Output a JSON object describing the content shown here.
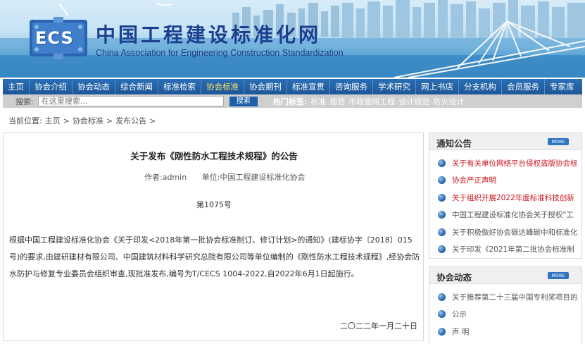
{
  "header": {
    "logo_text": "ECS",
    "site_title_cn": "中国工程建设标准化网",
    "site_title_en": "China Association for Engineering Construction Standardization"
  },
  "nav": {
    "items": [
      {
        "label": "主页",
        "active": false
      },
      {
        "label": "协会介绍",
        "active": false
      },
      {
        "label": "协会动态",
        "active": false
      },
      {
        "label": "综合新闻",
        "active": false
      },
      {
        "label": "标准检索",
        "active": false
      },
      {
        "label": "协会标准",
        "active": true
      },
      {
        "label": "协会期刊",
        "active": false
      },
      {
        "label": "标准宣贯",
        "active": false
      },
      {
        "label": "咨询服务",
        "active": false
      },
      {
        "label": "学术研究",
        "active": false
      },
      {
        "label": "网上书店",
        "active": false
      },
      {
        "label": "分支机构",
        "active": false
      },
      {
        "label": "会员服务",
        "active": false
      },
      {
        "label": "专家库",
        "active": false
      }
    ]
  },
  "search": {
    "label": "搜索:",
    "placeholder": "在这里搜索...",
    "button_label": "搜索",
    "hot_label": "热门标签:",
    "hot_tags": [
      "标准",
      "规范",
      "市政管网工程",
      "设计规范",
      "防火设计"
    ]
  },
  "breadcrumb": {
    "items": [
      "当前位置:",
      "主页",
      ">",
      "协会标准",
      ">",
      "发布公告",
      ">"
    ]
  },
  "article": {
    "title": "关于发布《刚性防水工程技术规程》的公告",
    "author": "作者:admin",
    "unit": "单位:中国工程建设标准化协会",
    "number": "第1075号",
    "body": "根据中国工程建设标准化协会《关于印发<2018年第一批协会标准制订、修订计划>的通知》(建标协字〔2018〕015号)的要求,由建研建材有限公司、中国建筑材料科学研究总院有限公司等单位编制的《刚性防水工程技术规程》,经协会防水防护与修复专业委员会组织审查,现批准发布,编号为T/CECS 1004-2022,自2022年6月1日起施行。",
    "date": "二〇二二年一月二十日"
  },
  "sidebar": {
    "notices": {
      "title": "通知公告",
      "more_label": "MORE",
      "items": [
        {
          "text": "关于有关单位网络平台侵权盗版协会标",
          "style": "red"
        },
        {
          "text": "协会严正声明",
          "style": "red"
        },
        {
          "text": "关于组织开展2022年度标准科技创新",
          "style": "red"
        },
        {
          "text": "中国工程建设标准化协会关于授权\"工",
          "style": "gray"
        },
        {
          "text": "关于积极做好协会碳达峰碳中和标准化",
          "style": "gray"
        },
        {
          "text": "关于印发《2021年第二批协会标准制",
          "style": "gray"
        }
      ]
    },
    "news": {
      "title": "协会动态",
      "more_label": "MORE",
      "items": [
        {
          "text": "关于推荐第二十三届中国专利奖项目的",
          "style": "gray"
        },
        {
          "text": "公示",
          "style": "gray"
        },
        {
          "text": "声 明",
          "style": "gray"
        }
      ]
    }
  }
}
